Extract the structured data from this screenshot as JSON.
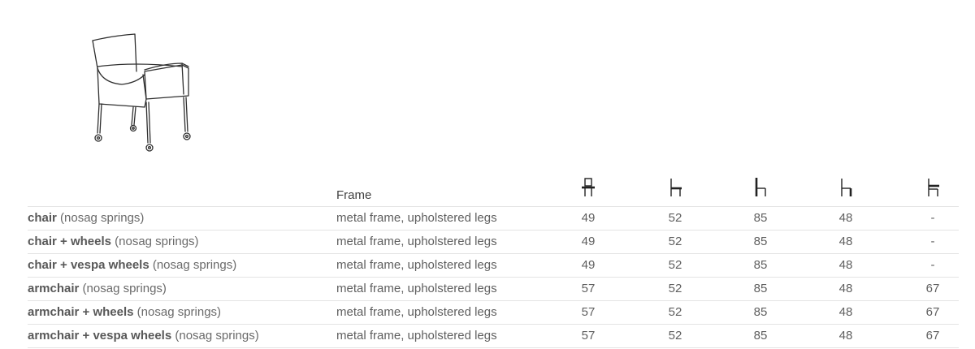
{
  "product": {
    "illustration_icon": "armchair-with-wheels-line-drawing"
  },
  "table": {
    "frame_header": "Frame",
    "dimension_icons": [
      "seat-height-icon",
      "seat-depth-icon",
      "total-height-icon",
      "seat-height-side-icon",
      "armrest-height-icon"
    ],
    "rows": [
      {
        "name": "chair",
        "note": " (nosag springs)",
        "frame": "metal frame, upholstered legs",
        "d1": "49",
        "d2": "52",
        "d3": "85",
        "d4": "48",
        "d5": "-"
      },
      {
        "name": "chair + wheels",
        "note": " (nosag springs)",
        "frame": "metal frame, upholstered legs",
        "d1": "49",
        "d2": "52",
        "d3": "85",
        "d4": "48",
        "d5": "-"
      },
      {
        "name": "chair + vespa wheels",
        "note": " (nosag springs)",
        "frame": "metal frame, upholstered legs",
        "d1": "49",
        "d2": "52",
        "d3": "85",
        "d4": "48",
        "d5": "-"
      },
      {
        "name": "armchair",
        "note": " (nosag springs)",
        "frame": "metal frame, upholstered legs",
        "d1": "57",
        "d2": "52",
        "d3": "85",
        "d4": "48",
        "d5": "67"
      },
      {
        "name": "armchair + wheels",
        "note": " (nosag springs)",
        "frame": "metal frame, upholstered legs",
        "d1": "57",
        "d2": "52",
        "d3": "85",
        "d4": "48",
        "d5": "67"
      },
      {
        "name": "armchair + vespa wheels",
        "note": " (nosag springs)",
        "frame": "metal frame, upholstered legs",
        "d1": "57",
        "d2": "52",
        "d3": "85",
        "d4": "48",
        "d5": "67"
      }
    ]
  }
}
